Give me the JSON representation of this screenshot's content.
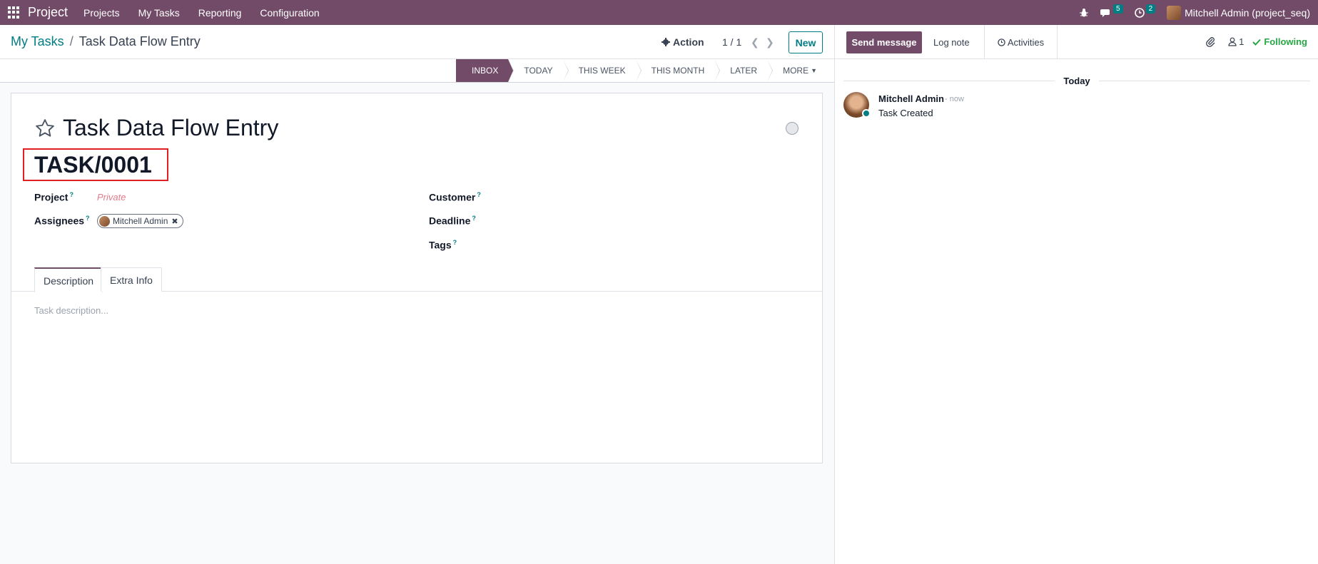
{
  "navbar": {
    "brand": "Project",
    "menu": [
      "Projects",
      "My Tasks",
      "Reporting",
      "Configuration"
    ],
    "messages_count": "5",
    "activities_count": "2",
    "user": "Mitchell Admin (project_seq)"
  },
  "control_panel": {
    "breadcrumb_parent": "My Tasks",
    "breadcrumb_separator": "/",
    "breadcrumb_current": "Task Data Flow Entry",
    "action_label": "Action",
    "pager": "1 / 1",
    "new_label": "New"
  },
  "stages": [
    "INBOX",
    "TODAY",
    "THIS WEEK",
    "THIS MONTH",
    "LATER",
    "MORE"
  ],
  "form": {
    "title": "Task Data Flow Entry",
    "sequence": "TASK/0001",
    "project_label": "Project",
    "project_placeholder": "Private",
    "assignees_label": "Assignees",
    "assignee": "Mitchell Admin",
    "customer_label": "Customer",
    "deadline_label": "Deadline",
    "tags_label": "Tags",
    "help_mark": "?",
    "tabs": [
      "Description",
      "Extra Info"
    ],
    "description_placeholder": "Task description..."
  },
  "chatter": {
    "send_message": "Send message",
    "log_note": "Log note",
    "activities": "Activities",
    "followers_count": "1",
    "following": "Following",
    "day": "Today",
    "messages": [
      {
        "author": "Mitchell Admin",
        "time": "- now",
        "body": "Task Created"
      }
    ]
  },
  "colors": {
    "brand": "#714b67",
    "accent": "#017e84",
    "following": "#28a745",
    "highlight_box": "#e02020"
  }
}
